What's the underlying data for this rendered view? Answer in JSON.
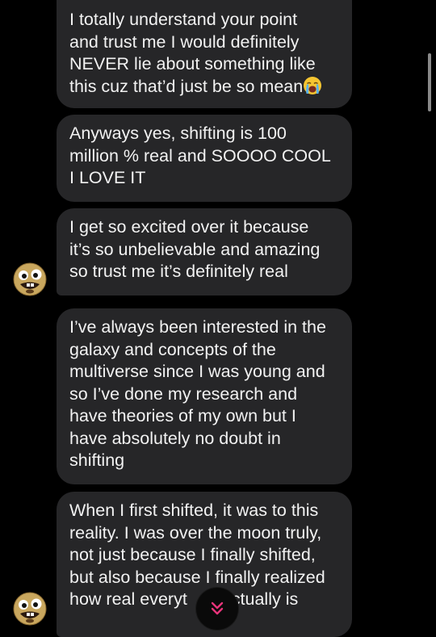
{
  "messages": [
    {
      "text": "I totally understand your point\nand trust me I would definitely\nNEVER lie about something like\nthis cuz that’d just be so mean",
      "emoji": "loudly-crying-face"
    },
    {
      "text": "Anyways yes, shifting is 100\nmillion % real and SOOOO COOL\nI LOVE IT"
    },
    {
      "text": "I get so excited over it because\nit’s so unbelievable and amazing\nso trust me it’s definitely real"
    },
    {
      "text": "I’ve always been interested in the\ngalaxy and concepts of the\nmultiverse since I was young and\nso I’ve done my research and\nhave theories of my own but I\nhave absolutely no doubt in\nshifting"
    },
    {
      "text": "When I first shifted, it was to this\nreality. I was over the moon truly,\nnot just because I finally shifted,\nbut also because I finally realized\nhow real everyt          actually is"
    }
  ],
  "icons": {
    "avatar": "goofy-face-avatar",
    "jump": "double-chevron-down-icon"
  },
  "colors": {
    "background": "#000000",
    "bubble": "#262628",
    "text": "#f2f2f2",
    "accent": "#e8347a"
  }
}
